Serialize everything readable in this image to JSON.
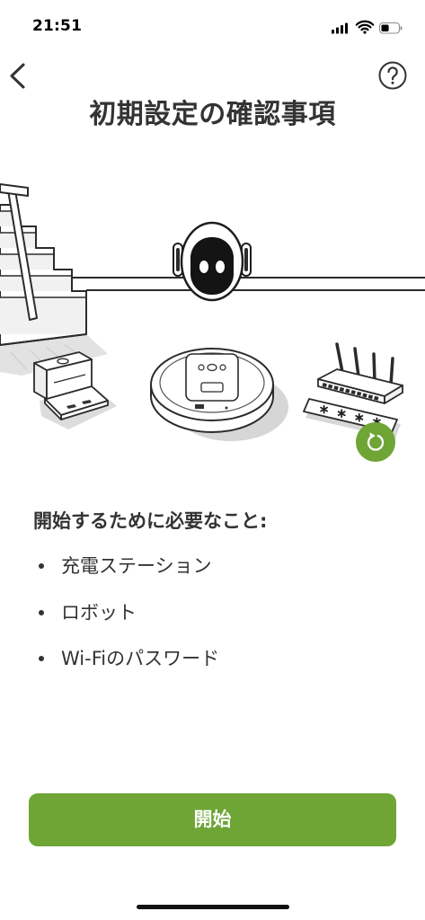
{
  "status_bar": {
    "time": "21:51",
    "signal_bars": 4,
    "battery_level": 0.45,
    "icons": [
      "signal-icon",
      "wifi-icon",
      "battery-icon"
    ]
  },
  "nav": {
    "back_icon": "chevron-left-icon",
    "help_icon": "help-circle-icon"
  },
  "header": {
    "title": "初期設定の確認事項"
  },
  "illustration": {
    "replay_icon": "replay-icon"
  },
  "requirements": {
    "heading": "開始するために必要なこと:",
    "items": [
      "充電ステーション",
      "ロボット",
      "Wi-Fiのパスワード"
    ]
  },
  "start_button": {
    "label": "開始"
  },
  "theme": {
    "accent": "#6ea535",
    "text": "#333333",
    "background": "#ffffff"
  }
}
